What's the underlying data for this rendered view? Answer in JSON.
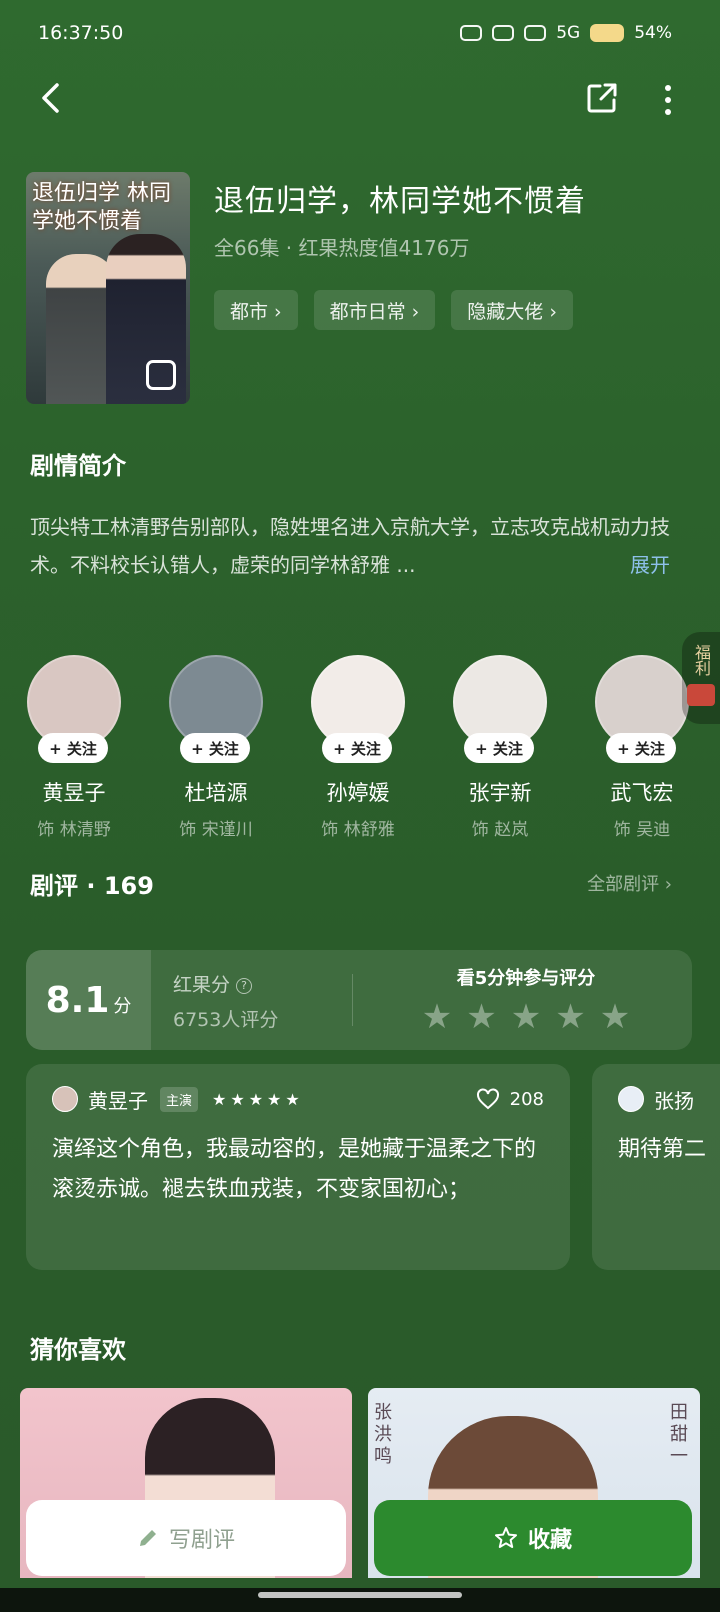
{
  "status_bar": {
    "time": "16:37:50",
    "network": "5G",
    "battery": "54%"
  },
  "drama": {
    "title": "退伍归学，林同学她不惯着",
    "meta": "全66集 · 红果热度值4176万",
    "poster_title": "退伍归学 林同学她不惯着",
    "tags": [
      "都市 ›",
      "都市日常 ›",
      "隐藏大佬 ›"
    ]
  },
  "synopsis": {
    "heading": "剧情简介",
    "text": "顶尖特工林清野告别部队，隐姓埋名进入京航大学，立志攻克战机动力技术。不料校长认错人，虚荣的同学林舒雅 ...",
    "expand_label": "展开"
  },
  "cast": {
    "follow_label": "+ 关注",
    "members": [
      {
        "name": "黄昱子",
        "role": "饰 林清野",
        "avatar_color": "#d9c7c2"
      },
      {
        "name": "杜培源",
        "role": "饰 宋谨川",
        "avatar_color": "#7d8a92"
      },
      {
        "name": "孙婷媛",
        "role": "饰 林舒雅",
        "avatar_color": "#f2ece8"
      },
      {
        "name": "张宇新",
        "role": "饰 赵岚",
        "avatar_color": "#ece8e4"
      },
      {
        "name": "武飞宏",
        "role": "饰 吴迪",
        "avatar_color": "#d8d0cc"
      }
    ]
  },
  "fuli": {
    "label": "福利"
  },
  "reviews": {
    "heading": "剧评 · 169",
    "all_label": "全部剧评 ›",
    "score": "8.1",
    "score_unit": "分",
    "score_label": "红果分",
    "rater_count": "6753人评分",
    "rate_prompt": "看5分钟参与评分",
    "star_symbol": "★★★★★",
    "cards": [
      {
        "user": "黄昱子",
        "badge": "主演",
        "stars": "★★★★★",
        "likes": "208",
        "text": "演绎这个角色，我最动容的，是她藏于温柔之下的滚烫赤诚。褪去铁血戎装，不变家国初心；"
      },
      {
        "user": "张扬",
        "text": "期待第二"
      }
    ]
  },
  "guess": {
    "heading": "猜你喜欢",
    "thumb2_left_text": "张洪鸣",
    "thumb2_right_text": "田甜一"
  },
  "actions": {
    "write_label": "写剧评",
    "fav_label": "收藏"
  }
}
